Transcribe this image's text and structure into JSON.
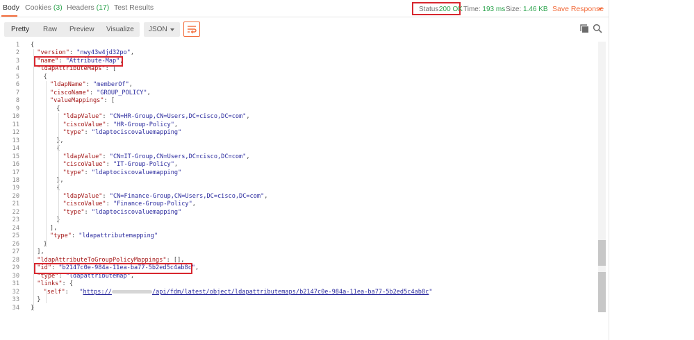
{
  "tabs": [
    {
      "label": "Body",
      "count": ""
    },
    {
      "label": "Cookies",
      "count": "(3)"
    },
    {
      "label": "Headers",
      "count": "(17)"
    },
    {
      "label": "Test Results",
      "count": ""
    }
  ],
  "status": {
    "label": "Status:",
    "value": "200 OK"
  },
  "time": {
    "label": "Time:",
    "value": "193 ms"
  },
  "size": {
    "label": "Size:",
    "value": "1.46 KB"
  },
  "save_response": "Save Response",
  "view_modes": [
    "Pretty",
    "Raw",
    "Preview",
    "Visualize"
  ],
  "format": "JSON",
  "icons": {
    "wrap": "wrap-lines-icon",
    "copy": "copy-icon",
    "search": "search-icon",
    "caret": "chevron-down-icon"
  },
  "colors": {
    "accent": "#f26b3a",
    "success": "#2da44e",
    "highlight": "#d7262e",
    "json_key": "#a31515",
    "json_string": "#2a2a9e"
  },
  "code_lines": [
    {
      "n": "1",
      "indent": 0,
      "t": [
        [
          "p",
          "{"
        ]
      ]
    },
    {
      "n": "2",
      "indent": 1,
      "t": [
        [
          "k",
          "\"version\""
        ],
        [
          "p",
          ": "
        ],
        [
          "s",
          "\"nwy43w4jd32po\""
        ],
        [
          "p",
          ","
        ]
      ]
    },
    {
      "n": "3",
      "indent": 1,
      "t": [
        [
          "k",
          "\"name\""
        ],
        [
          "p",
          ": "
        ],
        [
          "s",
          "\"Attribute-Map\""
        ],
        [
          "p",
          ","
        ]
      ]
    },
    {
      "n": "4",
      "indent": 1,
      "t": [
        [
          "k",
          "\"ldapAttributeMaps\""
        ],
        [
          "p",
          ": ["
        ]
      ]
    },
    {
      "n": "5",
      "indent": 2,
      "t": [
        [
          "p",
          "{"
        ]
      ]
    },
    {
      "n": "6",
      "indent": 3,
      "t": [
        [
          "k",
          "\"ldapName\""
        ],
        [
          "p",
          ": "
        ],
        [
          "s",
          "\"memberOf\""
        ],
        [
          "p",
          ","
        ]
      ]
    },
    {
      "n": "7",
      "indent": 3,
      "t": [
        [
          "k",
          "\"ciscoName\""
        ],
        [
          "p",
          ": "
        ],
        [
          "s",
          "\"GROUP_POLICY\""
        ],
        [
          "p",
          ","
        ]
      ]
    },
    {
      "n": "8",
      "indent": 3,
      "t": [
        [
          "k",
          "\"valueMappings\""
        ],
        [
          "p",
          ": ["
        ]
      ]
    },
    {
      "n": "9",
      "indent": 4,
      "t": [
        [
          "p",
          "{"
        ]
      ]
    },
    {
      "n": "10",
      "indent": 5,
      "t": [
        [
          "k",
          "\"ldapValue\""
        ],
        [
          "p",
          ": "
        ],
        [
          "s",
          "\"CN=HR-Group,CN=Users,DC=cisco,DC=com\""
        ],
        [
          "p",
          ","
        ]
      ]
    },
    {
      "n": "11",
      "indent": 5,
      "t": [
        [
          "k",
          "\"ciscoValue\""
        ],
        [
          "p",
          ": "
        ],
        [
          "s",
          "\"HR-Group-Policy\""
        ],
        [
          "p",
          ","
        ]
      ]
    },
    {
      "n": "12",
      "indent": 5,
      "t": [
        [
          "k",
          "\"type\""
        ],
        [
          "p",
          ": "
        ],
        [
          "s",
          "\"ldaptociscovaluemapping\""
        ]
      ]
    },
    {
      "n": "13",
      "indent": 4,
      "t": [
        [
          "p",
          "},"
        ]
      ]
    },
    {
      "n": "14",
      "indent": 4,
      "t": [
        [
          "p",
          "{"
        ]
      ]
    },
    {
      "n": "15",
      "indent": 5,
      "t": [
        [
          "k",
          "\"ldapValue\""
        ],
        [
          "p",
          ": "
        ],
        [
          "s",
          "\"CN=IT-Group,CN=Users,DC=cisco,DC=com\""
        ],
        [
          "p",
          ","
        ]
      ]
    },
    {
      "n": "16",
      "indent": 5,
      "t": [
        [
          "k",
          "\"ciscoValue\""
        ],
        [
          "p",
          ": "
        ],
        [
          "s",
          "\"IT-Group-Policy\""
        ],
        [
          "p",
          ","
        ]
      ]
    },
    {
      "n": "17",
      "indent": 5,
      "t": [
        [
          "k",
          "\"type\""
        ],
        [
          "p",
          ": "
        ],
        [
          "s",
          "\"ldaptociscovaluemapping\""
        ]
      ]
    },
    {
      "n": "18",
      "indent": 4,
      "t": [
        [
          "p",
          "},"
        ]
      ]
    },
    {
      "n": "19",
      "indent": 4,
      "t": [
        [
          "p",
          "{"
        ]
      ]
    },
    {
      "n": "20",
      "indent": 5,
      "t": [
        [
          "k",
          "\"ldapValue\""
        ],
        [
          "p",
          ": "
        ],
        [
          "s",
          "\"CN=Finance-Group,CN=Users,DC=cisco,DC=com\""
        ],
        [
          "p",
          ","
        ]
      ]
    },
    {
      "n": "21",
      "indent": 5,
      "t": [
        [
          "k",
          "\"ciscoValue\""
        ],
        [
          "p",
          ": "
        ],
        [
          "s",
          "\"Finance-Group-Policy\""
        ],
        [
          "p",
          ","
        ]
      ]
    },
    {
      "n": "22",
      "indent": 5,
      "t": [
        [
          "k",
          "\"type\""
        ],
        [
          "p",
          ": "
        ],
        [
          "s",
          "\"ldaptociscovaluemapping\""
        ]
      ]
    },
    {
      "n": "23",
      "indent": 4,
      "t": [
        [
          "p",
          "}"
        ]
      ]
    },
    {
      "n": "24",
      "indent": 3,
      "t": [
        [
          "p",
          "],"
        ]
      ]
    },
    {
      "n": "25",
      "indent": 3,
      "t": [
        [
          "k",
          "\"type\""
        ],
        [
          "p",
          ": "
        ],
        [
          "s",
          "\"ldapattributemapping\""
        ]
      ]
    },
    {
      "n": "26",
      "indent": 2,
      "t": [
        [
          "p",
          "}"
        ]
      ]
    },
    {
      "n": "27",
      "indent": 1,
      "t": [
        [
          "p",
          "],"
        ]
      ]
    },
    {
      "n": "28",
      "indent": 1,
      "t": [
        [
          "k",
          "\"ldapAttributeToGroupPolicyMappings\""
        ],
        [
          "p",
          ": [],"
        ]
      ]
    },
    {
      "n": "29",
      "indent": 1,
      "t": [
        [
          "k",
          "\"id\""
        ],
        [
          "p",
          ": "
        ],
        [
          "s",
          "\"b2147c0e-984a-11ea-ba77-5b2ed5c4ab8c\""
        ],
        [
          "p",
          ","
        ]
      ]
    },
    {
      "n": "30",
      "indent": 1,
      "t": [
        [
          "k",
          "\"type\""
        ],
        [
          "p",
          ": "
        ],
        [
          "s",
          "\"ldapattributemap\""
        ],
        [
          "p",
          ","
        ]
      ]
    },
    {
      "n": "31",
      "indent": 1,
      "t": [
        [
          "k",
          "\"links\""
        ],
        [
          "p",
          ": {"
        ]
      ]
    },
    {
      "n": "32",
      "indent": 2,
      "t": [
        [
          "k",
          "\"self\""
        ],
        [
          "p",
          ":   "
        ],
        [
          "s",
          "\""
        ],
        [
          "u",
          "https://"
        ],
        [
          "blur",
          ""
        ],
        [
          "u",
          "/api/fdm/latest/object/ldapattributemaps/b2147c0e-984a-11ea-ba77-5b2ed5c4ab8c"
        ],
        [
          "s",
          "\""
        ]
      ]
    },
    {
      "n": "33",
      "indent": 1,
      "t": [
        [
          "p",
          "}"
        ]
      ]
    },
    {
      "n": "34",
      "indent": 0,
      "t": [
        [
          "p",
          "}"
        ]
      ]
    }
  ]
}
